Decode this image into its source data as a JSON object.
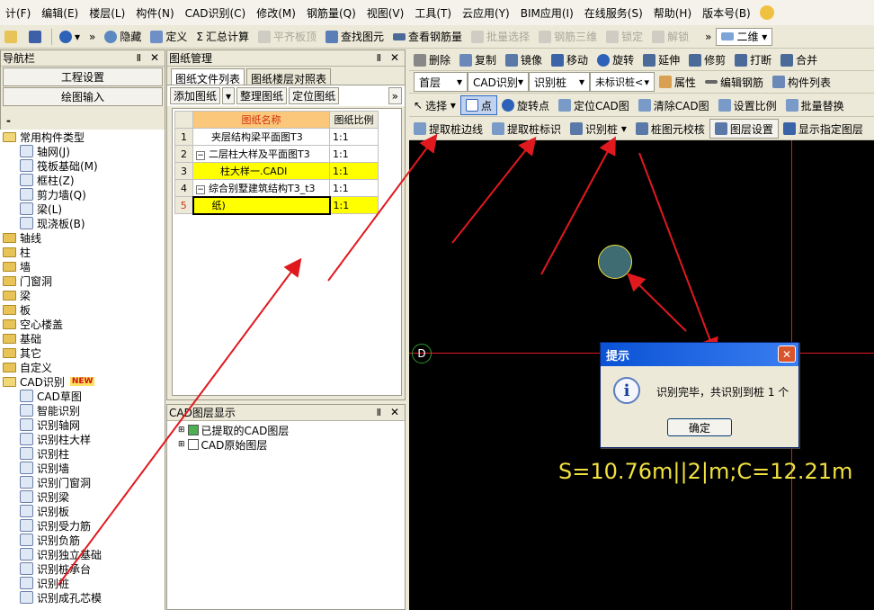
{
  "menu": [
    "计(F)",
    "编辑(E)",
    "楼层(L)",
    "构件(N)",
    "CAD识别(C)",
    "修改(M)",
    "钢筋量(Q)",
    "视图(V)",
    "工具(T)",
    "云应用(Y)",
    "BIM应用(I)",
    "在线服务(S)",
    "帮助(H)",
    "版本号(B)"
  ],
  "toolbar1": {
    "hide": "隐藏",
    "define": "定义",
    "sum": "汇总计算",
    "flat_top": "平齐板顶",
    "find": "查找图元",
    "view_rebar": "查看钢筋量",
    "batch": "批量选择",
    "rebar3d": "钢筋三维",
    "lock": "锁定",
    "unlock": "解锁",
    "view_mode": "二维"
  },
  "nav": {
    "title": "导航栏",
    "btn_settings": "工程设置",
    "btn_draw": "绘图输入",
    "indicator": "-",
    "tree": [
      {
        "t": "常用构件类型",
        "lvl": 0,
        "type": "folder-open"
      },
      {
        "t": "轴网(J)",
        "lvl": 1,
        "type": "item"
      },
      {
        "t": "筏板基础(M)",
        "lvl": 1,
        "type": "item"
      },
      {
        "t": "框柱(Z)",
        "lvl": 1,
        "type": "item"
      },
      {
        "t": "剪力墙(Q)",
        "lvl": 1,
        "type": "item"
      },
      {
        "t": "梁(L)",
        "lvl": 1,
        "type": "item"
      },
      {
        "t": "现浇板(B)",
        "lvl": 1,
        "type": "item"
      },
      {
        "t": "轴线",
        "lvl": 0,
        "type": "folder"
      },
      {
        "t": "柱",
        "lvl": 0,
        "type": "folder"
      },
      {
        "t": "墙",
        "lvl": 0,
        "type": "folder"
      },
      {
        "t": "门窗洞",
        "lvl": 0,
        "type": "folder"
      },
      {
        "t": "梁",
        "lvl": 0,
        "type": "folder"
      },
      {
        "t": "板",
        "lvl": 0,
        "type": "folder"
      },
      {
        "t": "空心楼盖",
        "lvl": 0,
        "type": "folder"
      },
      {
        "t": "基础",
        "lvl": 0,
        "type": "folder"
      },
      {
        "t": "其它",
        "lvl": 0,
        "type": "folder"
      },
      {
        "t": "自定义",
        "lvl": 0,
        "type": "folder"
      },
      {
        "t": "CAD识别",
        "lvl": 0,
        "type": "folder-open",
        "badge": "NEW"
      },
      {
        "t": "CAD草图",
        "lvl": 1,
        "type": "item"
      },
      {
        "t": "智能识别",
        "lvl": 1,
        "type": "item"
      },
      {
        "t": "识别轴网",
        "lvl": 1,
        "type": "item"
      },
      {
        "t": "识别柱大样",
        "lvl": 1,
        "type": "item"
      },
      {
        "t": "识别柱",
        "lvl": 1,
        "type": "item"
      },
      {
        "t": "识别墙",
        "lvl": 1,
        "type": "item"
      },
      {
        "t": "识别门窗洞",
        "lvl": 1,
        "type": "item"
      },
      {
        "t": "识别梁",
        "lvl": 1,
        "type": "item"
      },
      {
        "t": "识别板",
        "lvl": 1,
        "type": "item"
      },
      {
        "t": "识别受力筋",
        "lvl": 1,
        "type": "item"
      },
      {
        "t": "识别负筋",
        "lvl": 1,
        "type": "item"
      },
      {
        "t": "识别独立基础",
        "lvl": 1,
        "type": "item"
      },
      {
        "t": "识别桩承台",
        "lvl": 1,
        "type": "item"
      },
      {
        "t": "识别桩",
        "lvl": 1,
        "type": "item"
      },
      {
        "t": "识别成孔芯模",
        "lvl": 1,
        "type": "item"
      }
    ]
  },
  "drawing": {
    "title": "图纸管理",
    "tab1": "图纸文件列表",
    "tab2": "图纸楼层对照表",
    "add": "添加图纸",
    "tidy": "整理图纸",
    "locate": "定位图纸",
    "col_name": "图纸名称",
    "col_scale": "图纸比例",
    "rows": [
      {
        "no": "1",
        "name": "夹层结构梁平面图T3",
        "scale": "1:1",
        "hl": false,
        "tree": ""
      },
      {
        "no": "2",
        "name": "二层柱大样及平面图T3",
        "scale": "1:1",
        "hl": false,
        "tree": "−"
      },
      {
        "no": "3",
        "name": "柱大样一.CADI",
        "scale": "1:1",
        "hl": true,
        "tree": ""
      },
      {
        "no": "4",
        "name": "综合别墅建筑结构T3_t3",
        "scale": "1:1",
        "hl": false,
        "tree": "−"
      },
      {
        "no": "5",
        "name": "纸)",
        "scale": "1:1",
        "hl": true,
        "tree": ""
      }
    ]
  },
  "cadlayer": {
    "title": "CAD图层显示",
    "l1": "已提取的CAD图层",
    "l2": "CAD原始图层"
  },
  "toolbar2": {
    "delete": "删除",
    "copy": "复制",
    "mirror": "镜像",
    "move": "移动",
    "rotate": "旋转",
    "extend": "延伸",
    "trim": "修剪",
    "break": "打断",
    "merge": "合并"
  },
  "toolbar3": {
    "floor": "首层",
    "cadrec": "CAD识别",
    "pile": "识别桩",
    "unmarked": "未标识桩<",
    "props": "属性",
    "edit_rebar": "编辑钢筋",
    "comp_list": "构件列表"
  },
  "toolbar4": {
    "select": "选择",
    "point": "点",
    "rot_point": "旋转点",
    "locate_cad": "定位CAD图",
    "clear_cad": "清除CAD图",
    "set_scale": "设置比例",
    "batch_replace": "批量替换"
  },
  "toolbar5": {
    "extract_edge": "提取桩边线",
    "extract_mark": "提取桩标识",
    "rec_pile": "识别桩",
    "check": "桩图元校核",
    "layer_set": "图层设置",
    "show_layer": "显示指定图层"
  },
  "canvas": {
    "axis_label": "D",
    "status": "S=10.76m||2|m;C=12.21m"
  },
  "dialog": {
    "title": "提示",
    "message": "识别完毕，共识别到桩 1 个",
    "ok": "确定"
  },
  "colors": {
    "accent": "#e0191f",
    "yellow": "#ffff00",
    "status_text": "#f0e040",
    "pile": "#3f6c72"
  }
}
